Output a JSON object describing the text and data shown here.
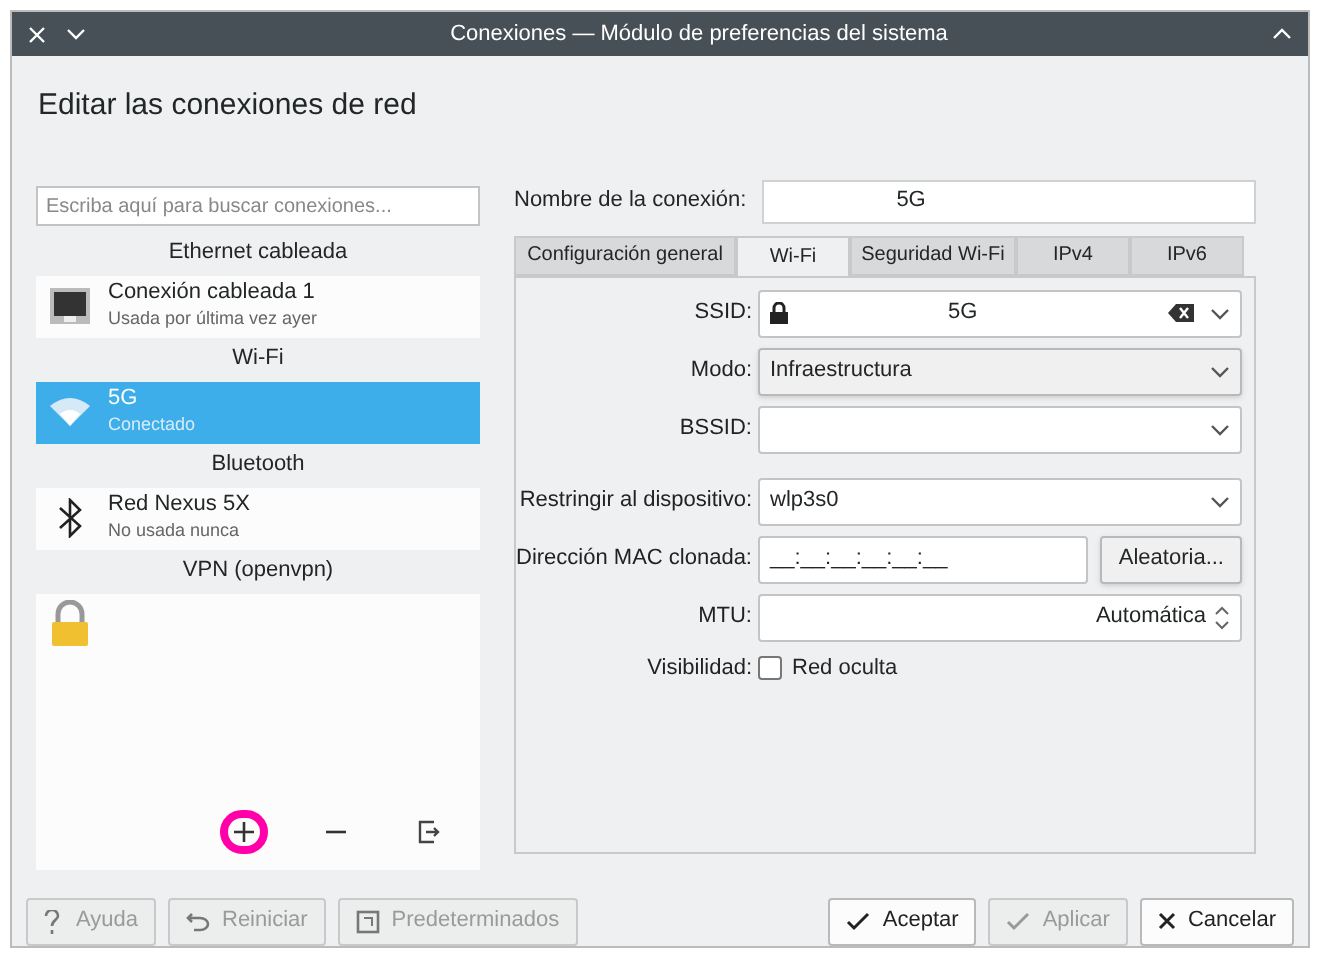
{
  "window": {
    "title": "Conexiones — Módulo de preferencias del sistema"
  },
  "heading": "Editar las conexiones de red",
  "search": {
    "placeholder": "Escriba aquí para buscar conexiones..."
  },
  "groups": [
    {
      "title": "Ethernet cableada",
      "items": [
        {
          "kind": "wired",
          "name": "Conexión cableada 1",
          "status": "Usada por última vez ayer",
          "selected": false
        }
      ]
    },
    {
      "title": "Wi-Fi",
      "items": [
        {
          "kind": "wifi",
          "name": "5G",
          "status": "Conectado",
          "selected": true
        }
      ]
    },
    {
      "title": "Bluetooth",
      "items": [
        {
          "kind": "bluetooth",
          "name": "Red Nexus 5X",
          "status": "No usada nunca",
          "selected": false
        }
      ]
    },
    {
      "title": "VPN (openvpn)",
      "items": [
        {
          "kind": "vpn",
          "selected": false
        }
      ]
    }
  ],
  "list_actions": [
    {
      "kind": "add",
      "highlighted": true
    },
    {
      "kind": "remove",
      "highlighted": false
    },
    {
      "kind": "export",
      "highlighted": false
    }
  ],
  "connection_name": {
    "label": "Nombre de la conexión:",
    "value": "5G"
  },
  "tabs": [
    {
      "label": "Configuración general",
      "selected": false
    },
    {
      "label": "Wi-Fi",
      "selected": true
    },
    {
      "label": "Seguridad Wi-Fi",
      "selected": false
    },
    {
      "label": "IPv4",
      "selected": false
    },
    {
      "label": "IPv6",
      "selected": false
    }
  ],
  "fields": [
    {
      "kind": "ssid",
      "label": "SSID:",
      "value": "5G"
    },
    {
      "kind": "combo",
      "label": "Modo:",
      "value": "Infraestructura"
    },
    {
      "kind": "combo_edit",
      "label": "BSSID:"
    },
    {
      "kind": "combo_edit",
      "label": "Restringir al dispositivo:",
      "value": "wlp3s0"
    },
    {
      "kind": "mac",
      "label": "Dirección MAC clonada:",
      "value": "__:__:__:__:__:__",
      "button": "Aleatoria..."
    },
    {
      "kind": "spin",
      "label": "MTU:",
      "value": "Automática"
    },
    {
      "kind": "checkbox",
      "label": "Visibilidad:",
      "text": "Red oculta",
      "checked": false
    }
  ],
  "footer_left": [
    {
      "kind": "help",
      "label": "Ayuda",
      "disabled": true
    },
    {
      "kind": "reset",
      "label": "Reiniciar",
      "disabled": true
    },
    {
      "kind": "defaults",
      "label": "Predeterminados",
      "disabled": true
    }
  ],
  "footer_right": [
    {
      "kind": "ok",
      "label": "Aceptar",
      "disabled": false
    },
    {
      "kind": "apply",
      "label": "Aplicar",
      "disabled": true
    },
    {
      "kind": "cancel",
      "label": "Cancelar",
      "disabled": false
    }
  ]
}
